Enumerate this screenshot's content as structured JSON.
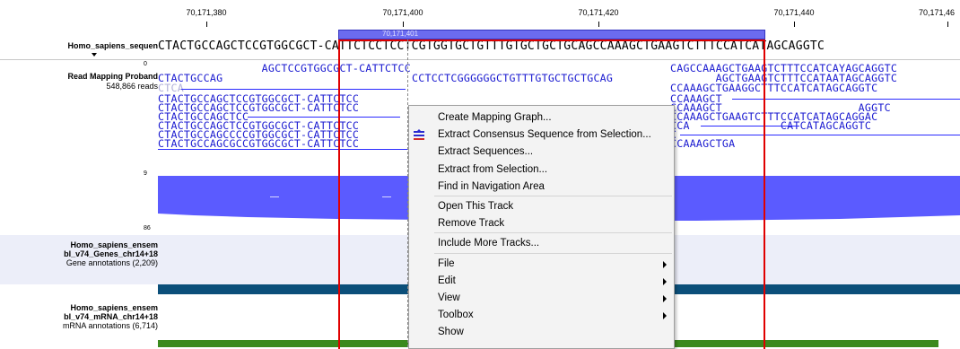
{
  "ruler": {
    "labels": [
      "70,171,380",
      "70,171,400",
      "70,171,420",
      "70,171,440",
      "70,171,46"
    ],
    "selection_label": "70,171,401"
  },
  "reference": {
    "label": "Homo_sapiens_sequen",
    "sequence": "CTACTGCCAGCTCCGTGGCGCT-CATTCTCCTCCTCGTGGTGCTGTTTGTGCTGCTGCAGCCAAAGCTGAAGTCTTTCCATCATAGCAGGTC"
  },
  "read_track": {
    "title": "Read Mapping Proband",
    "reads": "548,866 reads",
    "scale_top": "0",
    "scale_mid": "9",
    "scale_bottom": "86",
    "reads_left": [
      "                AGCTCCGTGGCGCT-CATTCTCC",
      "CTACTGCCAG",
      "CTCA",
      "CTACTGCCAGCTCCGTGGCGCT-CATTCTCC",
      "CTACTGCCAGCTCCGTGGCGCT-CATTCTCC",
      "CTACTGCCAGCTCC",
      "CTACTGCCAGCTCCGTGGCGCT-CATTCTCC",
      "CTACTGCCAGCCCCGTGGCGCT-CATTCTCC",
      "CTACTGCCAGCGCCGTGGCGCT-CATTCTCC"
    ],
    "reads_right": [
      "CAGCCAAAGCTGAAGTCTTTCCATCAYAGCAGGTC",
      "       AGCTGAAGTCTTTCCATAATAGCAGGTC",
      "CCAAAGCTGAAGGCTTTCCATCATAGCAGGTC",
      "CCAAAGCT",
      "CCAAAGCT                     AGGTC",
      "CCAAAGCTGAAGTCTTTCCATCATAGCAGGAC",
      "CCA              CATCATAGCAGGTC",
      "C",
      "CCAAAGCTGA"
    ],
    "read_mid_fragment": "CCTCCTCGGGGGGCTGTTTGTGCTGCTGCAG"
  },
  "gene_track": {
    "title_line1": "Homo_sapiens_ensem",
    "title_line2": "bl_v74_Genes_chr14+18",
    "subtitle": "Gene annotations (2,209)"
  },
  "mrna_track": {
    "title_line1": "Homo_sapiens_ensem",
    "title_line2": "bl_v74_mRNA_chr14+18",
    "subtitle": "mRNA annotations (6,714)"
  },
  "context_menu": {
    "items": [
      {
        "label": "Create Mapping Graph...",
        "submenu": false,
        "icon": ""
      },
      {
        "label": "Extract Consensus Sequence from Selection...",
        "submenu": false,
        "icon": "consensus-extract-icon"
      },
      {
        "label": "Extract Sequences...",
        "submenu": false,
        "icon": ""
      },
      {
        "label": "Extract from Selection...",
        "submenu": false,
        "icon": ""
      },
      {
        "label": "Find in Navigation Area",
        "submenu": false,
        "icon": ""
      },
      {
        "label": "Open This Track",
        "submenu": false,
        "icon": ""
      },
      {
        "label": "Remove Track",
        "submenu": false,
        "icon": ""
      },
      {
        "label": "Include More Tracks...",
        "submenu": false,
        "icon": ""
      },
      {
        "label": "File",
        "submenu": true,
        "icon": ""
      },
      {
        "label": "Edit",
        "submenu": true,
        "icon": ""
      },
      {
        "label": "View",
        "submenu": true,
        "icon": ""
      },
      {
        "label": "Toolbox",
        "submenu": true,
        "icon": ""
      },
      {
        "label": "Show",
        "submenu": true,
        "icon": ""
      }
    ]
  },
  "colors": {
    "selection_border": "#e00000",
    "coverage": "#5b5bff",
    "gene_bar": "#0b4f7a",
    "mrna_bar": "#3b8a1e",
    "read_text": "#1a1ad0"
  }
}
